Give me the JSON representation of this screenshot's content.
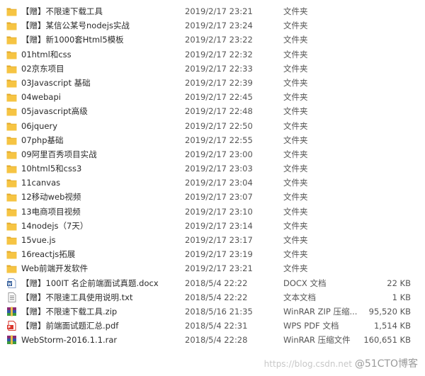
{
  "files": [
    {
      "name": "【赠】不限速下载工具",
      "date": "2019/2/17 23:21",
      "type": "文件夹",
      "size": "",
      "icon": "folder-icon"
    },
    {
      "name": "【赠】某信公某号nodejs实战",
      "date": "2019/2/17 23:24",
      "type": "文件夹",
      "size": "",
      "icon": "folder-icon"
    },
    {
      "name": "【赠】新1000套Html5模板",
      "date": "2019/2/17 23:22",
      "type": "文件夹",
      "size": "",
      "icon": "folder-icon"
    },
    {
      "name": "01html和css",
      "date": "2019/2/17 22:32",
      "type": "文件夹",
      "size": "",
      "icon": "folder-icon"
    },
    {
      "name": "02京东项目",
      "date": "2019/2/17 22:33",
      "type": "文件夹",
      "size": "",
      "icon": "folder-icon"
    },
    {
      "name": "03Javascript 基础",
      "date": "2019/2/17 22:39",
      "type": "文件夹",
      "size": "",
      "icon": "folder-icon"
    },
    {
      "name": "04webapi",
      "date": "2019/2/17 22:45",
      "type": "文件夹",
      "size": "",
      "icon": "folder-icon"
    },
    {
      "name": "05javascript高级",
      "date": "2019/2/17 22:48",
      "type": "文件夹",
      "size": "",
      "icon": "folder-icon"
    },
    {
      "name": "06jquery",
      "date": "2019/2/17 22:50",
      "type": "文件夹",
      "size": "",
      "icon": "folder-icon"
    },
    {
      "name": "07php基础",
      "date": "2019/2/17 22:55",
      "type": "文件夹",
      "size": "",
      "icon": "folder-icon"
    },
    {
      "name": "09阿里百秀项目实战",
      "date": "2019/2/17 23:00",
      "type": "文件夹",
      "size": "",
      "icon": "folder-icon"
    },
    {
      "name": "10html5和css3",
      "date": "2019/2/17 23:03",
      "type": "文件夹",
      "size": "",
      "icon": "folder-icon"
    },
    {
      "name": "11canvas",
      "date": "2019/2/17 23:04",
      "type": "文件夹",
      "size": "",
      "icon": "folder-icon"
    },
    {
      "name": "12移动web视频",
      "date": "2019/2/17 23:07",
      "type": "文件夹",
      "size": "",
      "icon": "folder-icon"
    },
    {
      "name": "13电商项目视频",
      "date": "2019/2/17 23:10",
      "type": "文件夹",
      "size": "",
      "icon": "folder-icon"
    },
    {
      "name": "14nodejs（7天）",
      "date": "2019/2/17 23:14",
      "type": "文件夹",
      "size": "",
      "icon": "folder-icon"
    },
    {
      "name": "15vue.js",
      "date": "2019/2/17 23:17",
      "type": "文件夹",
      "size": "",
      "icon": "folder-icon"
    },
    {
      "name": "16reactjs拓展",
      "date": "2019/2/17 23:19",
      "type": "文件夹",
      "size": "",
      "icon": "folder-icon"
    },
    {
      "name": "Web前端开发软件",
      "date": "2019/2/17 23:21",
      "type": "文件夹",
      "size": "",
      "icon": "folder-icon"
    },
    {
      "name": "【赠】100IT 名企前端面试真题.docx",
      "date": "2018/5/4 22:22",
      "type": "DOCX 文档",
      "size": "22 KB",
      "icon": "docx-icon"
    },
    {
      "name": "【赠】不限速工具使用说明.txt",
      "date": "2018/5/4 22:22",
      "type": "文本文档",
      "size": "1 KB",
      "icon": "txt-icon"
    },
    {
      "name": "【赠】不限速下载工具.zip",
      "date": "2018/5/16 21:35",
      "type": "WinRAR ZIP 压缩...",
      "size": "95,520 KB",
      "icon": "winrar-icon"
    },
    {
      "name": "【赠】前端面试题汇总.pdf",
      "date": "2018/5/4 22:31",
      "type": "WPS PDF 文档",
      "size": "1,514 KB",
      "icon": "pdf-icon"
    },
    {
      "name": "WebStorm-2016.1.1.rar",
      "date": "2018/5/4 22:28",
      "type": "WinRAR 压缩文件",
      "size": "160,651 KB",
      "icon": "winrar-icon"
    }
  ],
  "watermark": {
    "url": "https://blog.csdn.net",
    "brand": "@51CTO博客"
  },
  "colors": {
    "folder": "#f6c443",
    "folder_dark": "#e0a82a",
    "docx": "#2b5797",
    "pdf": "#d9352b",
    "winrar": "#8a2a72"
  }
}
